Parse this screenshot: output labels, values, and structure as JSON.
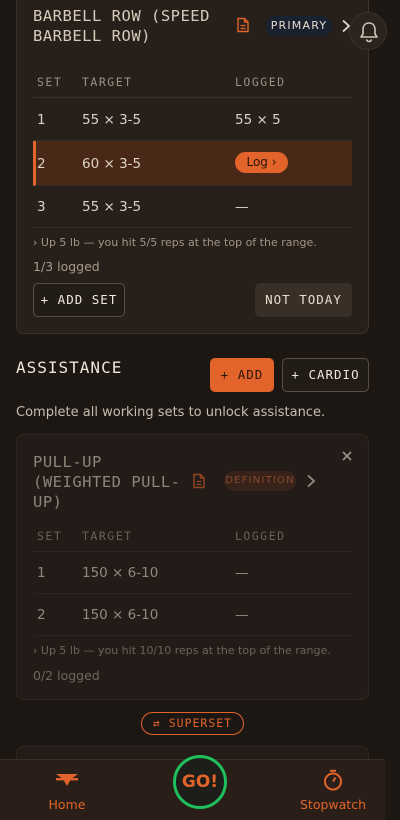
{
  "primary_exercise": {
    "title": "BARBELL ROW (SPEED BARBELL ROW)",
    "badge": "PRIMARY",
    "columns": [
      "SET",
      "TARGET",
      "LOGGED"
    ],
    "sets": [
      {
        "set": "1",
        "target": "55 × 3-5",
        "logged": "55 × 5"
      },
      {
        "set": "2",
        "target": "60 × 3-5",
        "logged": "Log ›"
      },
      {
        "set": "3",
        "target": "55 × 3-5",
        "logged": "—"
      }
    ],
    "hint": "›  Up 5 lb — you hit 5/5 reps at the top of the range.",
    "logged_count": "1/3 logged",
    "add_set_label": "+ ADD SET",
    "not_today_label": "NOT TODAY"
  },
  "assistance": {
    "title": "ASSISTANCE",
    "add_label": "+ ADD",
    "cardio_label": "+ CARDIO",
    "description": "Complete all working sets to unlock assistance."
  },
  "assist_exercise": {
    "title_line1": "PULL-UP",
    "title_line2": "(WEIGHTED PULL-",
    "title_line3": "UP)",
    "badge": "DEFINITION",
    "columns": [
      "SET",
      "TARGET",
      "LOGGED"
    ],
    "sets": [
      {
        "set": "1",
        "target": "150 × 6-10",
        "logged": "—"
      },
      {
        "set": "2",
        "target": "150 × 6-10",
        "logged": "—"
      }
    ],
    "hint": "›  Up 5 lb — you hit 10/10 reps at the top of the range.",
    "logged_count": "0/2 logged"
  },
  "superset_label": "⇄ SUPERSET",
  "nav": {
    "home_label": "Home",
    "go_label": "GO!",
    "stopwatch_label": "Stopwatch"
  },
  "colors": {
    "accent": "#e2642a",
    "go_ring": "#1fbf5b",
    "background": "#1c1713"
  }
}
